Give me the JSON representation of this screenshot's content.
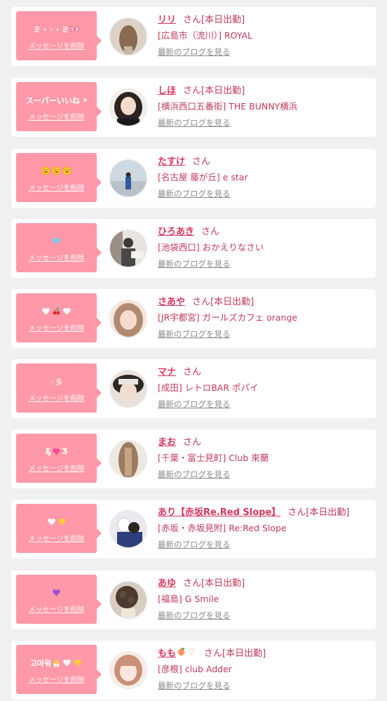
{
  "blog_link_label": "最新のブログを見る",
  "delete_label": "メッセージを削除",
  "honorific": "さん",
  "cards": [
    {
      "name": "リリ",
      "status": "[本日出勤]",
      "shop": "[広島市（流川）] ROYAL",
      "message_text": "ミ・◦・ミ",
      "message_icons": [
        "ribbon-icon"
      ],
      "avatar_colors": [
        "#d9cfc4",
        "#8a6a50"
      ]
    },
    {
      "name": "しほ",
      "status": "[本日出勤]",
      "shop": "[横浜西口五番街] THE BUNNY横浜",
      "message_text": "スーパーいいね",
      "message_icons": [
        "sparkle-icon"
      ],
      "avatar_colors": [
        "#f2eeea",
        "#2b2422"
      ]
    },
    {
      "name": "たすけ",
      "status": "",
      "shop": "[名古屋 藤が丘] e star",
      "message_text": "",
      "message_icons": [
        "grin-icon",
        "grin-icon",
        "grin-icon"
      ],
      "avatar_colors": [
        "#cfd9e2",
        "#2f5a9e"
      ]
    },
    {
      "name": "ひろあき",
      "status": "",
      "shop": "[池袋西口] おかえりなさい",
      "message_text": "",
      "message_icons": [
        "blue-heart-icon"
      ],
      "avatar_colors": [
        "#e7e4df",
        "#3b3a38"
      ]
    },
    {
      "name": "さあや",
      "status": "[本日出勤]",
      "shop": "[JR宇都宮] ガールズカフェ orange",
      "message_text": "",
      "message_icons": [
        "white-heart-icon",
        "cherry-icon",
        "white-heart-icon"
      ],
      "avatar_colors": [
        "#f4e6dc",
        "#b08a70"
      ]
    },
    {
      "name": "マナ",
      "status": "",
      "shop": "[成田] レトロBAR ポパイ",
      "message_text": "◦彡",
      "message_icons": [],
      "avatar_colors": [
        "#e9e2dc",
        "#2d2825"
      ]
    },
    {
      "name": "まお",
      "status": "",
      "shop": "[千葉・富士見町] Club 來蘭",
      "message_text": "",
      "message_icons": [
        "sparkling-heart-icon"
      ],
      "message_text_left": "Ƹ̵̡",
      "message_text_right": "Ʒ",
      "avatar_colors": [
        "#eee8e2",
        "#9c7b5e"
      ]
    },
    {
      "name": "あり【赤坂Re.Red Slope】",
      "status": "[本日出勤]",
      "shop": "[赤坂・赤坂見附] Re:Red Slope",
      "message_text": "",
      "message_icons": [
        "white-heart-icon",
        "yellow-heart-icon"
      ],
      "avatar_colors": [
        "#2c3f7a",
        "#e9e9ee"
      ]
    },
    {
      "name": "あゆ",
      "status": "[本日出勤]",
      "shop": "[福島] G Smile",
      "message_text": "",
      "message_icons": [
        "purple-heart-icon"
      ],
      "avatar_colors": [
        "#d8cdc2",
        "#4a3a30"
      ]
    },
    {
      "name": "もも",
      "status": "[本日出勤]",
      "shop": "[彦根] club Adder",
      "message_text": "고마워",
      "message_icons": [
        "chick-icon",
        "white-heart-icon",
        "yellow-heart-icon"
      ],
      "name_icons": [
        "peach-icon",
        "white-heart-icon"
      ],
      "avatar_colors": [
        "#f7ece6",
        "#c9917a"
      ]
    }
  ],
  "colors": {
    "bubble": "#ff98a8",
    "name": "#d8355f",
    "text": "#c0395a",
    "blog_link": "#8a8a8a",
    "background": "#f0f0f0"
  }
}
